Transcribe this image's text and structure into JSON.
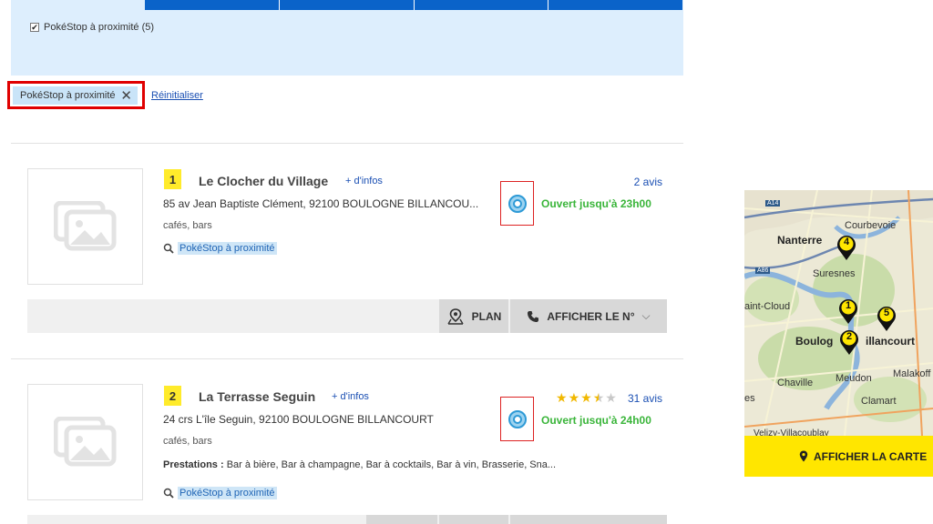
{
  "filters": {
    "checkbox_label": "PokéStop à proximité (5)",
    "checkbox_checked": true,
    "active_chip": "PokéStop à proximité",
    "reset_link": "Réinitialiser"
  },
  "results": [
    {
      "number": "1",
      "name": "Le Clocher du Village",
      "more_info": "+ d'infos",
      "reviews": "2 avis",
      "address": "85 av Jean Baptiste Clément, 92100 BOULOGNE BILLANCOU...",
      "category": "cafés, bars",
      "status": "Ouvert jusqu'à 23h00",
      "pokestop": "PokéStop à proximité",
      "btn_plan": "PLAN",
      "btn_phone": "AFFICHER LE N°"
    },
    {
      "number": "2",
      "name": "La Terrasse Seguin",
      "more_info": "+ d'infos",
      "rating": 3.5,
      "rating_max": 5,
      "reviews": "31 avis",
      "address": "24 crs L'île Seguin, 92100 BOULOGNE BILLANCOURT",
      "category": "cafés, bars",
      "services_label": "Prestations :",
      "services": "Bar à bière,  Bar à champagne,  Bar à cocktails,  Bar à vin,  Brasserie,  Sna...",
      "status": "Ouvert jusqu'à 24h00",
      "pokestop": "PokéStop à proximité"
    }
  ],
  "map": {
    "labels": {
      "a14": "A14",
      "a86": "A86",
      "courbevoie": "Courbevoie",
      "nanterre": "Nanterre",
      "suresnes": "Suresnes",
      "saint_cloud": "aint-Cloud",
      "boulogne": "Boulog",
      "billancourt": "illancourt",
      "chaville": "Chaville",
      "meudon": "Meudon",
      "malakoff": "Malakoff",
      "clamart": "Clamart",
      "velizy": "Velizy-Villacoublay",
      "es": "es"
    },
    "pins": [
      "4",
      "1",
      "5",
      "2"
    ],
    "button_label": "AFFICHER LA CARTE"
  },
  "colors": {
    "accent_blue": "#0a63c9",
    "panel_bg": "#ddeefd",
    "highlight_red": "#e00000",
    "open_green": "#3ab53a",
    "number_yellow": "#ffeb2b",
    "map_button_yellow": "#ffe600"
  }
}
